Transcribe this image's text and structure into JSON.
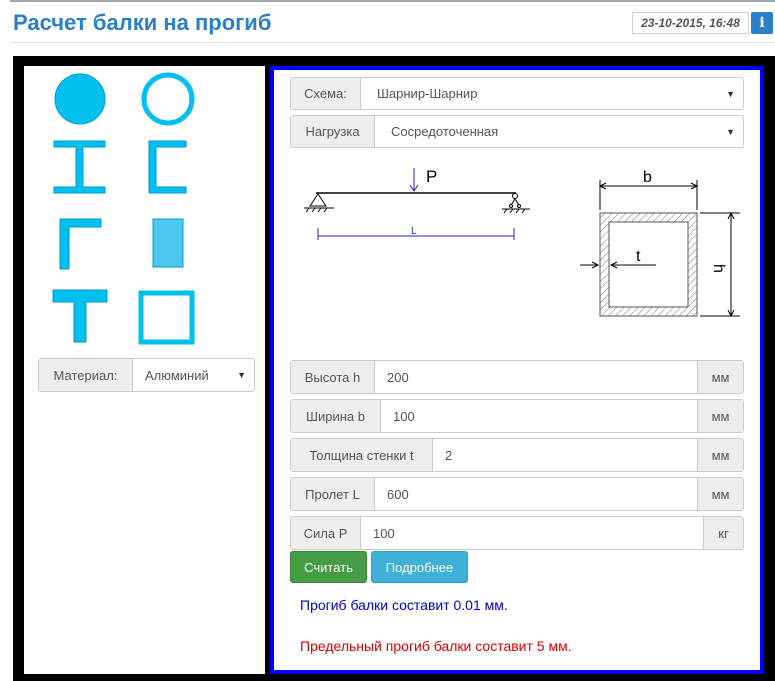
{
  "header": {
    "title": "Расчет балки на прогиб",
    "date": "23-10-2015, 16:48",
    "info_icon": "i"
  },
  "profiles": [
    {
      "name": "round-bar"
    },
    {
      "name": "round-tube"
    },
    {
      "name": "i-beam"
    },
    {
      "name": "channel"
    },
    {
      "name": "angle"
    },
    {
      "name": "rectangular-bar"
    },
    {
      "name": "t-beam"
    },
    {
      "name": "square-tube"
    }
  ],
  "colors": {
    "profile": "#00c0f0",
    "frame": "#000000",
    "panel_border": "#0000ff"
  },
  "material": {
    "label": "Материал:",
    "value": "Алюминий"
  },
  "scheme": {
    "label": "Схема:",
    "value": "Шарнир-Шарнир"
  },
  "load": {
    "label": "Нагрузка",
    "value": "Сосредоточенная"
  },
  "diagram": {
    "force_label": "P",
    "span_label": "L",
    "width_label": "b",
    "height_label": "h",
    "thickness_label": "t"
  },
  "fields": {
    "height": {
      "label": "Высота h",
      "value": "200",
      "unit": "мм"
    },
    "width": {
      "label": "Ширина b",
      "value": "100",
      "unit": "мм"
    },
    "thickness": {
      "label": "Толщина стенки t",
      "value": "2",
      "unit": "мм"
    },
    "span": {
      "label": "Пролет L",
      "value": "600",
      "unit": "мм"
    },
    "force": {
      "label": "Сила P",
      "value": "100",
      "unit": "кг"
    }
  },
  "buttons": {
    "calculate": "Считать",
    "details": "Подробнее"
  },
  "results": {
    "deflection": "Прогиб балки составит 0.01 мм.",
    "limit": "Предельный прогиб балки составит 5 мм."
  }
}
